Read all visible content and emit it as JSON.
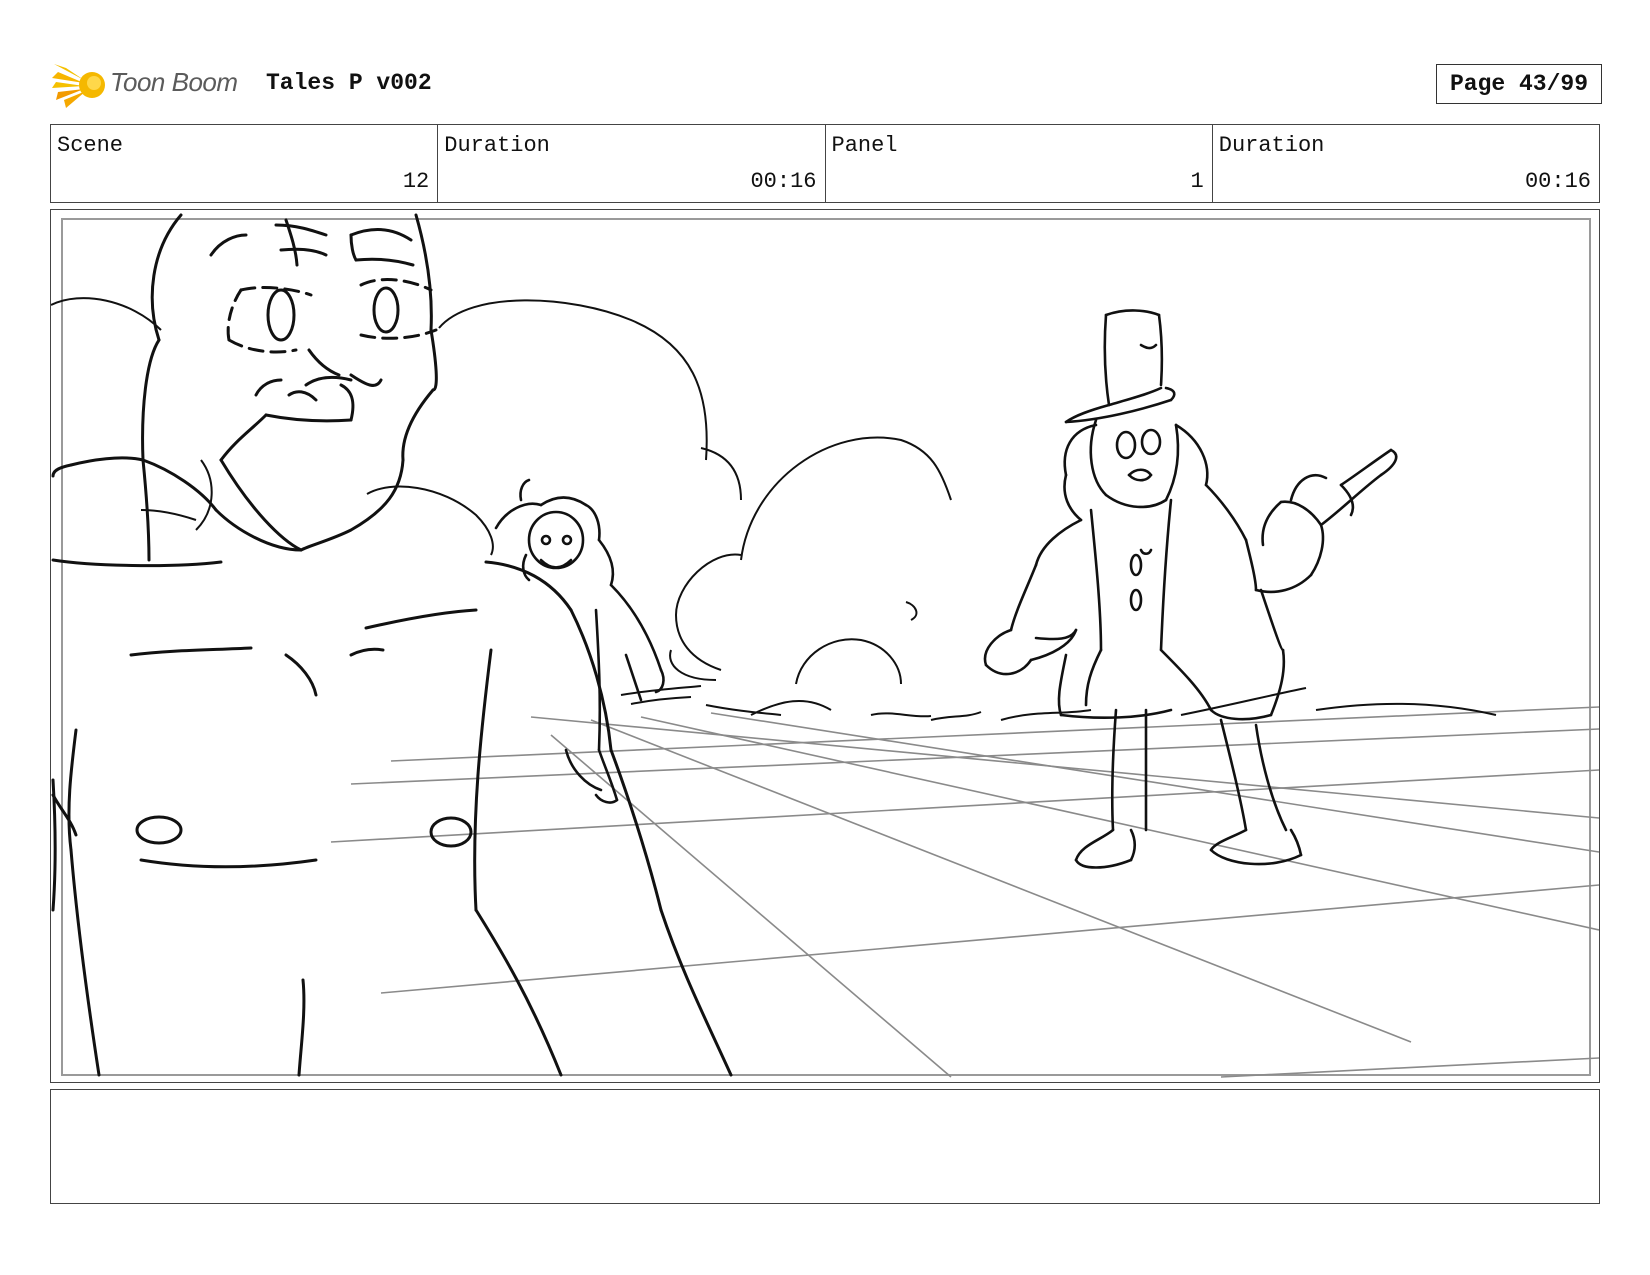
{
  "header": {
    "logo_text": "Toon Boom",
    "project_title": "Tales P v002",
    "page_label": "Page 43/99"
  },
  "info": {
    "scene_label": "Scene",
    "scene_value": "12",
    "scene_duration_label": "Duration",
    "scene_duration_value": "00:16",
    "panel_label": "Panel",
    "panel_value": "1",
    "panel_duration_label": "Duration",
    "panel_duration_value": "00:16"
  },
  "icons": {
    "logo": "toon-boom-sunburst-icon"
  },
  "colors": {
    "logo_yellow": "#f5c000",
    "logo_orange": "#f29a00",
    "sketch_line": "#111111",
    "perspective_line": "#8a8a8a"
  },
  "notes": {
    "text": ""
  }
}
